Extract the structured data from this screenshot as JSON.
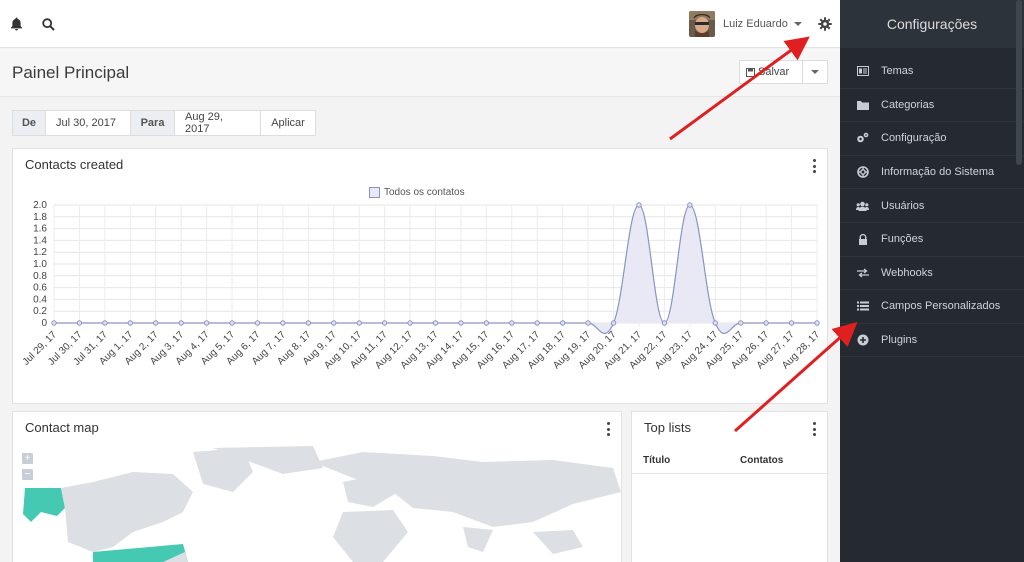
{
  "header": {
    "user_name": "Luiz Eduardo"
  },
  "page": {
    "title": "Painel Principal",
    "save_label": "Salvar"
  },
  "date_filter": {
    "from_label": "De",
    "from_value": "Jul 30, 2017",
    "to_label": "Para",
    "to_value": "Aug 29, 2017",
    "apply_label": "Aplicar"
  },
  "contacts_card": {
    "title": "Contacts created"
  },
  "chart_data": {
    "type": "area",
    "legend": [
      "Todos os contatos"
    ],
    "categories": [
      "Jul 29, 17",
      "Jul 30, 17",
      "Jul 31, 17",
      "Aug 1, 17",
      "Aug 2, 17",
      "Aug 3, 17",
      "Aug 4, 17",
      "Aug 5, 17",
      "Aug 6, 17",
      "Aug 7, 17",
      "Aug 8, 17",
      "Aug 9, 17",
      "Aug 10, 17",
      "Aug 11, 17",
      "Aug 12, 17",
      "Aug 13, 17",
      "Aug 14, 17",
      "Aug 15, 17",
      "Aug 16, 17",
      "Aug 17, 17",
      "Aug 18, 17",
      "Aug 19, 17",
      "Aug 20, 17",
      "Aug 21, 17",
      "Aug 22, 17",
      "Aug 23, 17",
      "Aug 24, 17",
      "Aug 25, 17",
      "Aug 26, 17",
      "Aug 27, 17",
      "Aug 28, 17"
    ],
    "series": [
      {
        "name": "Todos os contatos",
        "values": [
          0,
          0,
          0,
          0,
          0,
          0,
          0,
          0,
          0,
          0,
          0,
          0,
          0,
          0,
          0,
          0,
          0,
          0,
          0,
          0,
          0,
          0,
          0,
          2,
          0,
          2,
          0,
          0,
          0,
          0,
          0
        ]
      }
    ],
    "yticks": [
      "0",
      "0.2",
      "0.4",
      "0.6",
      "0.8",
      "1.0",
      "1.2",
      "1.4",
      "1.6",
      "1.8",
      "2.0"
    ],
    "ylim": [
      0,
      2
    ],
    "grid": true,
    "legend_position": "top-center",
    "colors": {
      "line": "#8a93c4",
      "fill": "#e8e9f5"
    }
  },
  "map_card": {
    "title": "Contact map",
    "zoom_in": "+",
    "zoom_out": "−",
    "colors": {
      "land": "#dcdfe4",
      "highlight": "#45c9b3"
    }
  },
  "top_lists": {
    "title": "Top lists",
    "columns": [
      "Título",
      "Contatos"
    ]
  },
  "sidebar": {
    "title": "Configurações",
    "items": [
      {
        "label": "Temas",
        "icon": "themes-icon"
      },
      {
        "label": "Categorias",
        "icon": "folder-icon"
      },
      {
        "label": "Configuração",
        "icon": "gears-icon"
      },
      {
        "label": "Informação do Sistema",
        "icon": "lifebuoy-icon"
      },
      {
        "label": "Usuários",
        "icon": "users-icon"
      },
      {
        "label": "Funções",
        "icon": "lock-icon"
      },
      {
        "label": "Webhooks",
        "icon": "exchange-icon"
      },
      {
        "label": "Campos Personalizados",
        "icon": "list-icon"
      },
      {
        "label": "Plugins",
        "icon": "plus-circle-icon"
      }
    ]
  },
  "colors": {
    "sidebar_bg": "#252a30",
    "annotation_arrow": "#e02020"
  }
}
